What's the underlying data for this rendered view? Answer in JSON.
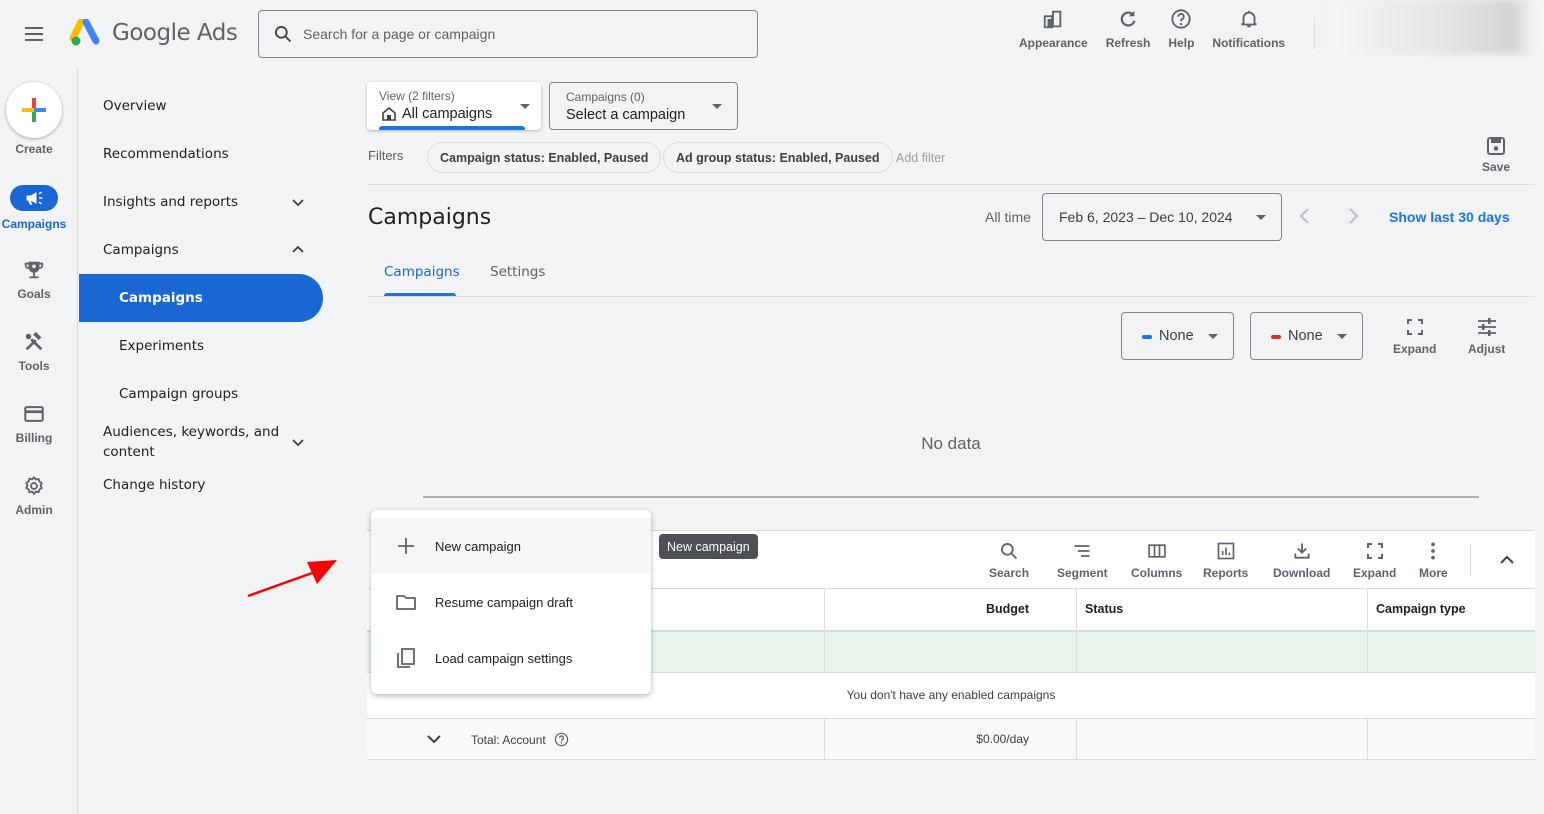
{
  "app": {
    "name": "Google Ads",
    "search_placeholder": "Search for a page or campaign"
  },
  "top_actions": [
    {
      "label": "Appearance",
      "icon": "appearance-icon"
    },
    {
      "label": "Refresh",
      "icon": "refresh-icon"
    },
    {
      "label": "Help",
      "icon": "help-icon"
    },
    {
      "label": "Notifications",
      "icon": "bell-icon"
    }
  ],
  "rail": {
    "create_label": "Create",
    "items": [
      {
        "label": "Campaigns",
        "icon": "megaphone-icon",
        "active": true
      },
      {
        "label": "Goals",
        "icon": "trophy-icon"
      },
      {
        "label": "Tools",
        "icon": "tools-icon"
      },
      {
        "label": "Billing",
        "icon": "credit-card-icon"
      },
      {
        "label": "Admin",
        "icon": "gear-icon"
      }
    ]
  },
  "nav": {
    "items": [
      {
        "label": "Overview"
      },
      {
        "label": "Recommendations"
      },
      {
        "label": "Insights and reports",
        "chevron": "down"
      },
      {
        "label": "Campaigns",
        "chevron": "up"
      },
      {
        "label": "Campaigns",
        "sub": true,
        "active": true
      },
      {
        "label": "Experiments",
        "sub": true
      },
      {
        "label": "Campaign groups",
        "sub": true
      },
      {
        "label": "Audiences, keywords, and content",
        "chevron": "down"
      },
      {
        "label": "Change history"
      }
    ]
  },
  "view_select": {
    "label": "View (2 filters)",
    "value": "All campaigns"
  },
  "campaign_select": {
    "label": "Campaigns (0)",
    "value": "Select a campaign"
  },
  "filters": {
    "label": "Filters",
    "chips": [
      "Campaign status: Enabled, Paused",
      "Ad group status: Enabled, Paused"
    ],
    "add_filter": "Add filter"
  },
  "save_label": "Save",
  "page": {
    "title": "Campaigns",
    "date_preset": "All time",
    "date_range": "Feb 6, 2023 – Dec 10, 2024",
    "show_last": "Show last 30 days"
  },
  "tabs": [
    {
      "label": "Campaigns",
      "active": true
    },
    {
      "label": "Settings"
    }
  ],
  "chart_controls": {
    "metric1": {
      "value": "None",
      "color": "#1a73e8"
    },
    "metric2": {
      "value": "None",
      "color": "#d93025"
    },
    "expand": "Expand",
    "adjust": "Adjust"
  },
  "chart": {
    "no_data": "No data"
  },
  "table_toolbar": [
    {
      "label": "Search",
      "icon": "search-icon"
    },
    {
      "label": "Segment",
      "icon": "segment-icon"
    },
    {
      "label": "Columns",
      "icon": "columns-icon"
    },
    {
      "label": "Reports",
      "icon": "reports-icon"
    },
    {
      "label": "Download",
      "icon": "download-icon"
    },
    {
      "label": "Expand",
      "icon": "expand-icon"
    },
    {
      "label": "More",
      "icon": "more-vert-icon"
    }
  ],
  "table": {
    "columns": [
      "",
      "Budget",
      "Status",
      "Campaign type"
    ],
    "empty_message": "You don't have any enabled campaigns",
    "total": {
      "label": "Total: Account",
      "budget": "$0.00/day"
    }
  },
  "menu": {
    "items": [
      {
        "label": "New campaign",
        "icon": "plus-icon"
      },
      {
        "label": "Resume campaign draft",
        "icon": "folder-icon"
      },
      {
        "label": "Load campaign settings",
        "icon": "copy-icon"
      }
    ]
  },
  "tooltip": "New campaign"
}
